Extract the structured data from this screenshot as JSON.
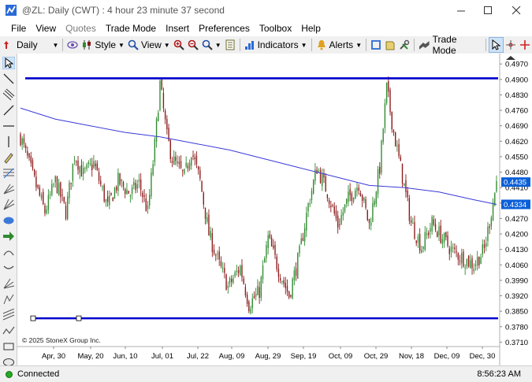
{
  "window": {
    "title": "@ZL: Daily (CWT) : 4 hour 23 minute 37 second"
  },
  "menu": {
    "items": [
      {
        "label": "File",
        "enabled": true
      },
      {
        "label": "View",
        "enabled": true
      },
      {
        "label": "Quotes",
        "enabled": false
      },
      {
        "label": "Trade Mode",
        "enabled": true
      },
      {
        "label": "Insert",
        "enabled": true
      },
      {
        "label": "Preferences",
        "enabled": true
      },
      {
        "label": "Toolbox",
        "enabled": true
      },
      {
        "label": "Help",
        "enabled": true
      }
    ]
  },
  "toolbar": {
    "interval": "Daily",
    "style_label": "Style",
    "view_label": "View",
    "indicators_label": "Indicators",
    "alerts_label": "Alerts",
    "trade_mode_label": "Trade Mode"
  },
  "status": {
    "connection": "Connected",
    "clock": "8:56:23 AM"
  },
  "colors": {
    "candle_up": "#2f8a2f",
    "candle_down": "#8b1a1a",
    "moving_average": "#3a3ad8",
    "trendline": "#0000cc",
    "price_tag": "#0a5fd8"
  },
  "chart_data": {
    "type": "candlestick",
    "symbol": "@ZL",
    "interval": "Daily",
    "copyright": "© 2025 StoneX Group Inc.",
    "x_tick_labels": [
      "Apr, 30",
      "May, 20",
      "Jun, 10",
      "Jul, 01",
      "Jul, 22",
      "Aug, 09",
      "Aug, 29",
      "Sep, 19",
      "Oct, 09",
      "Oct, 29",
      "Nov, 18",
      "Dec, 09",
      "Dec, 30"
    ],
    "y_tick_labels": [
      "0.4970",
      "0.4900",
      "0.4830",
      "0.4760",
      "0.4690",
      "0.4620",
      "0.4550",
      "0.4480",
      "0.4410",
      "0.4340",
      "0.4270",
      "0.4200",
      "0.4130",
      "0.4060",
      "0.3990",
      "0.3920",
      "0.3850",
      "0.3780",
      "0.3710"
    ],
    "ylim": [
      0.369,
      0.501
    ],
    "last_price": "0.4435",
    "moving_average_value": "0.4334",
    "horizontal_lines": [
      0.4905,
      0.3818
    ],
    "close_path": [
      [
        0,
        0.464
      ],
      [
        8,
        0.444
      ],
      [
        14,
        0.43
      ],
      [
        20,
        0.444
      ],
      [
        26,
        0.43
      ],
      [
        31,
        0.456
      ],
      [
        36,
        0.447
      ],
      [
        42,
        0.452
      ],
      [
        50,
        0.432
      ],
      [
        56,
        0.444
      ],
      [
        63,
        0.438
      ],
      [
        68,
        0.443
      ],
      [
        73,
        0.43
      ],
      [
        77,
        0.46
      ],
      [
        80,
        0.488
      ],
      [
        84,
        0.464
      ],
      [
        87,
        0.454
      ],
      [
        94,
        0.446
      ],
      [
        98,
        0.458
      ],
      [
        103,
        0.444
      ],
      [
        108,
        0.42
      ],
      [
        114,
        0.406
      ],
      [
        119,
        0.396
      ],
      [
        126,
        0.405
      ],
      [
        131,
        0.388
      ],
      [
        137,
        0.394
      ],
      [
        142,
        0.418
      ],
      [
        148,
        0.404
      ],
      [
        154,
        0.392
      ],
      [
        160,
        0.411
      ],
      [
        165,
        0.433
      ],
      [
        170,
        0.45
      ],
      [
        176,
        0.439
      ],
      [
        182,
        0.424
      ],
      [
        188,
        0.436
      ],
      [
        194,
        0.443
      ],
      [
        200,
        0.424
      ],
      [
        206,
        0.45
      ],
      [
        210,
        0.486
      ],
      [
        214,
        0.466
      ],
      [
        218,
        0.45
      ],
      [
        224,
        0.425
      ],
      [
        230,
        0.414
      ],
      [
        236,
        0.425
      ],
      [
        242,
        0.418
      ],
      [
        248,
        0.412
      ],
      [
        254,
        0.409
      ],
      [
        260,
        0.406
      ],
      [
        266,
        0.413
      ],
      [
        270,
        0.43
      ],
      [
        273,
        0.4435
      ]
    ],
    "moving_average_path": [
      [
        0,
        0.477
      ],
      [
        20,
        0.472
      ],
      [
        40,
        0.469
      ],
      [
        60,
        0.466
      ],
      [
        80,
        0.464
      ],
      [
        100,
        0.461
      ],
      [
        120,
        0.458
      ],
      [
        140,
        0.454
      ],
      [
        160,
        0.45
      ],
      [
        180,
        0.446
      ],
      [
        200,
        0.442
      ],
      [
        220,
        0.441
      ],
      [
        240,
        0.439
      ],
      [
        260,
        0.4355
      ],
      [
        273,
        0.4334
      ]
    ]
  }
}
